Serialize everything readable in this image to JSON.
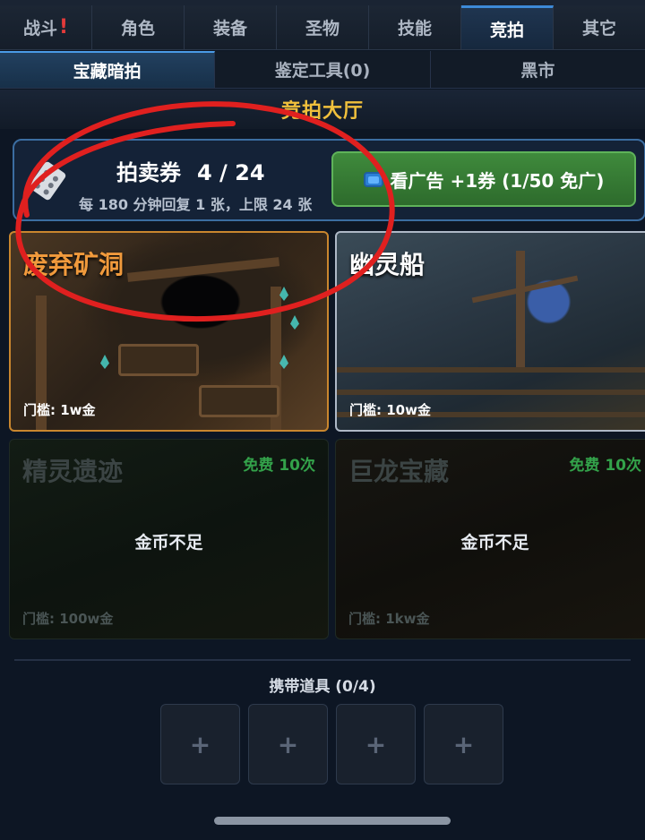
{
  "main_tabs": [
    {
      "label": "战斗",
      "alert": "!"
    },
    {
      "label": "角色"
    },
    {
      "label": "装备"
    },
    {
      "label": "圣物"
    },
    {
      "label": "技能"
    },
    {
      "label": "竞拍",
      "active": true
    },
    {
      "label": "其它"
    }
  ],
  "sub_tabs": [
    {
      "label": "宝藏暗拍",
      "active": true
    },
    {
      "label": "鉴定工具(0)"
    },
    {
      "label": "黑市"
    }
  ],
  "hall": {
    "title": "竞拍大厅"
  },
  "ticket": {
    "label": "拍卖券",
    "count": "4 / 24",
    "regen_info": "每 180 分钟回复 1 张，上限 24 张",
    "ad_button": "看广告 +1券 (1/50 免广)",
    "icon": "ticket-icon"
  },
  "dungeons": [
    {
      "name": "废弃矿洞",
      "entry": "门槛: 1w金",
      "accent": "#f19a3c"
    },
    {
      "name": "幽灵船",
      "entry": "门槛: 10w金"
    },
    {
      "name": "精灵遗迹",
      "entry": "门槛: 100w金",
      "free": "免费 10次",
      "locked": "金币不足"
    },
    {
      "name": "巨龙宝藏",
      "entry": "门槛: 1kw金",
      "free": "免费 10次",
      "locked": "金币不足"
    }
  ],
  "carry": {
    "label": "携带道具 (0/4)",
    "slots": [
      "+",
      "+",
      "+",
      "+"
    ]
  },
  "colors": {
    "accent_blue": "#3d8ad8",
    "gold_title": "#f0c03c",
    "ad_green": "#3f8a3c",
    "free_green": "#33a24a",
    "annotation_red": "#e0201f"
  }
}
